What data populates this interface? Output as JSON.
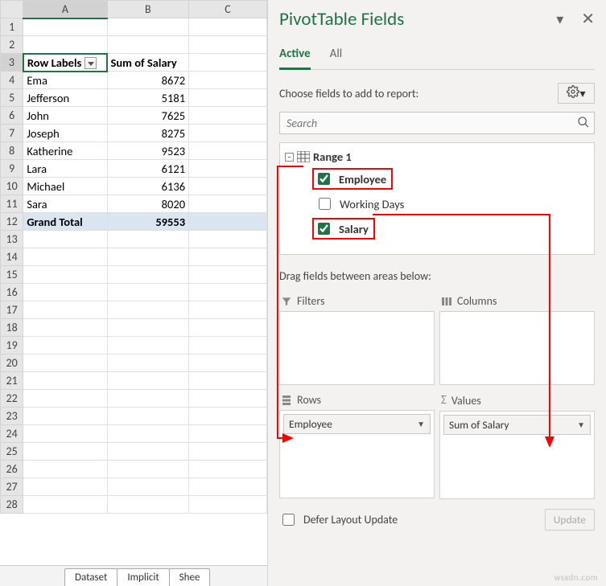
{
  "sheet": {
    "columns": [
      "A",
      "B",
      "C"
    ],
    "selected_col": "A",
    "selected_row": "3",
    "tab_labels": [
      "Dataset",
      "Implicit",
      "Shee"
    ],
    "pivot": {
      "row_labels_hdr": "Row Labels",
      "sum_hdr": "Sum of Salary",
      "rows": [
        {
          "label": "Ema",
          "value": "8672"
        },
        {
          "label": "Jefferson",
          "value": "5181"
        },
        {
          "label": "John",
          "value": "7625"
        },
        {
          "label": "Joseph",
          "value": "8275"
        },
        {
          "label": "Katherine",
          "value": "9523"
        },
        {
          "label": "Lara",
          "value": "6121"
        },
        {
          "label": "Michael",
          "value": "6136"
        },
        {
          "label": "Sara",
          "value": "8020"
        }
      ],
      "total_label": "Grand Total",
      "total_value": "59553"
    }
  },
  "pane": {
    "title": "PivotTable Fields",
    "tabs": {
      "active": "Active",
      "all": "All"
    },
    "choose_label": "Choose fields to add to report:",
    "search_placeholder": "Search",
    "range_label": "Range 1",
    "fields": {
      "employee": "Employee",
      "working_days": "Working Days",
      "salary": "Salary"
    },
    "drag_label": "Drag fields between areas below:",
    "areas": {
      "filters": "Filters",
      "columns": "Columns",
      "rows": "Rows",
      "values": "Values"
    },
    "row_item": "Employee",
    "value_item": "Sum of Salary",
    "defer_label": "Defer Layout Update",
    "update_label": "Update"
  },
  "watermark": "wsxdn.com"
}
